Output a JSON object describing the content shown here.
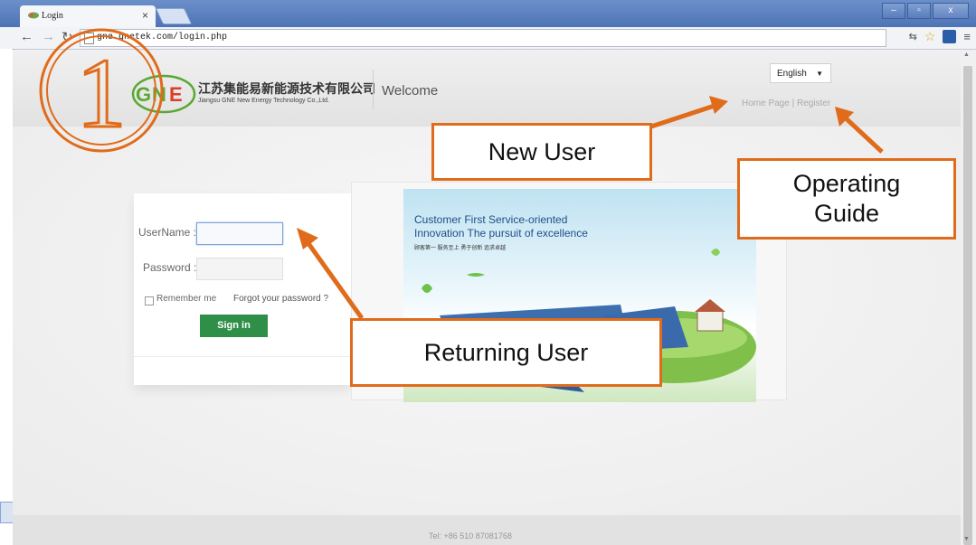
{
  "browser": {
    "tab_title": "Login",
    "tab_close": "×",
    "url_text": "gne.gnetek.com/login.php",
    "window_controls": [
      "–",
      "▫",
      "x"
    ]
  },
  "header": {
    "logo_mark": "GNE",
    "company_cn": "江苏集能易新能源技术有限公司",
    "company_en": "Jiangsu GNE New Energy Technology Co.,Ltd.",
    "welcome": "Welcome",
    "language": "English",
    "home_link": "Home Page",
    "separator": "|",
    "register_link": "Register"
  },
  "login": {
    "username_label": "UserName :",
    "password_label": "Password :",
    "remember_label": "Remember me",
    "forgot_link": "Forgot your password ?",
    "signin_label": "Sign in"
  },
  "banner": {
    "line1": "Customer First Service-oriented",
    "line2": "Innovation The pursuit of excellence",
    "line3": "顾客第一 服务至上 勇于创新 追求卓越"
  },
  "footer": {
    "text": "Tel: +86 510 87081768"
  },
  "annotations": {
    "step_number": "1",
    "new_user": "New User",
    "operating_guide_line1": "Operating",
    "operating_guide_line2": "Guide",
    "returning_user": "Returning User"
  },
  "colors": {
    "annotation_orange": "#e06b1a",
    "signin_green": "#2f8f48",
    "logo_green": "#5aa832",
    "logo_red": "#d8402a"
  }
}
